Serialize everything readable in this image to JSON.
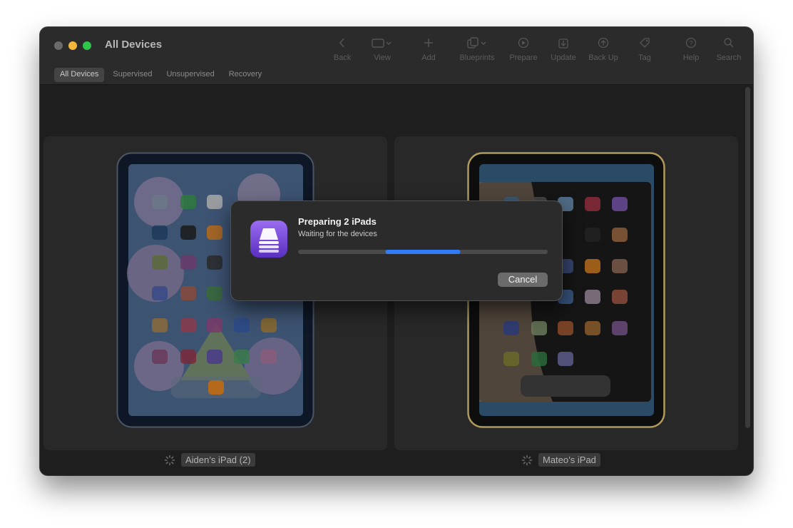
{
  "window": {
    "title": "All Devices"
  },
  "toolbar": {
    "items": [
      {
        "label": "Back",
        "icon": "chevron-left-icon"
      },
      {
        "label": "View",
        "icon": "view-icon"
      },
      {
        "label": "Add",
        "icon": "plus-icon"
      },
      {
        "label": "Blueprints",
        "icon": "blueprints-icon"
      },
      {
        "label": "Prepare",
        "icon": "prepare-icon"
      },
      {
        "label": "Update",
        "icon": "update-icon"
      },
      {
        "label": "Back Up",
        "icon": "backup-icon"
      },
      {
        "label": "Tag",
        "icon": "tag-icon"
      },
      {
        "label": "Help",
        "icon": "help-icon"
      },
      {
        "label": "Search",
        "icon": "search-icon"
      }
    ]
  },
  "tabs": [
    "All Devices",
    "Supervised",
    "Unsupervised",
    "Recovery"
  ],
  "devices": [
    {
      "name": "Aiden’s iPad (2)",
      "frame_color": "#0e1726"
    },
    {
      "name": "Mateo’s iPad",
      "frame_color": "#b09a5c"
    }
  ],
  "dialog": {
    "title": "Preparing 2 iPads",
    "subtitle": "Waiting for the devices",
    "progress": 0.3,
    "cancel_label": "Cancel",
    "accent": "#2f7cf6"
  }
}
